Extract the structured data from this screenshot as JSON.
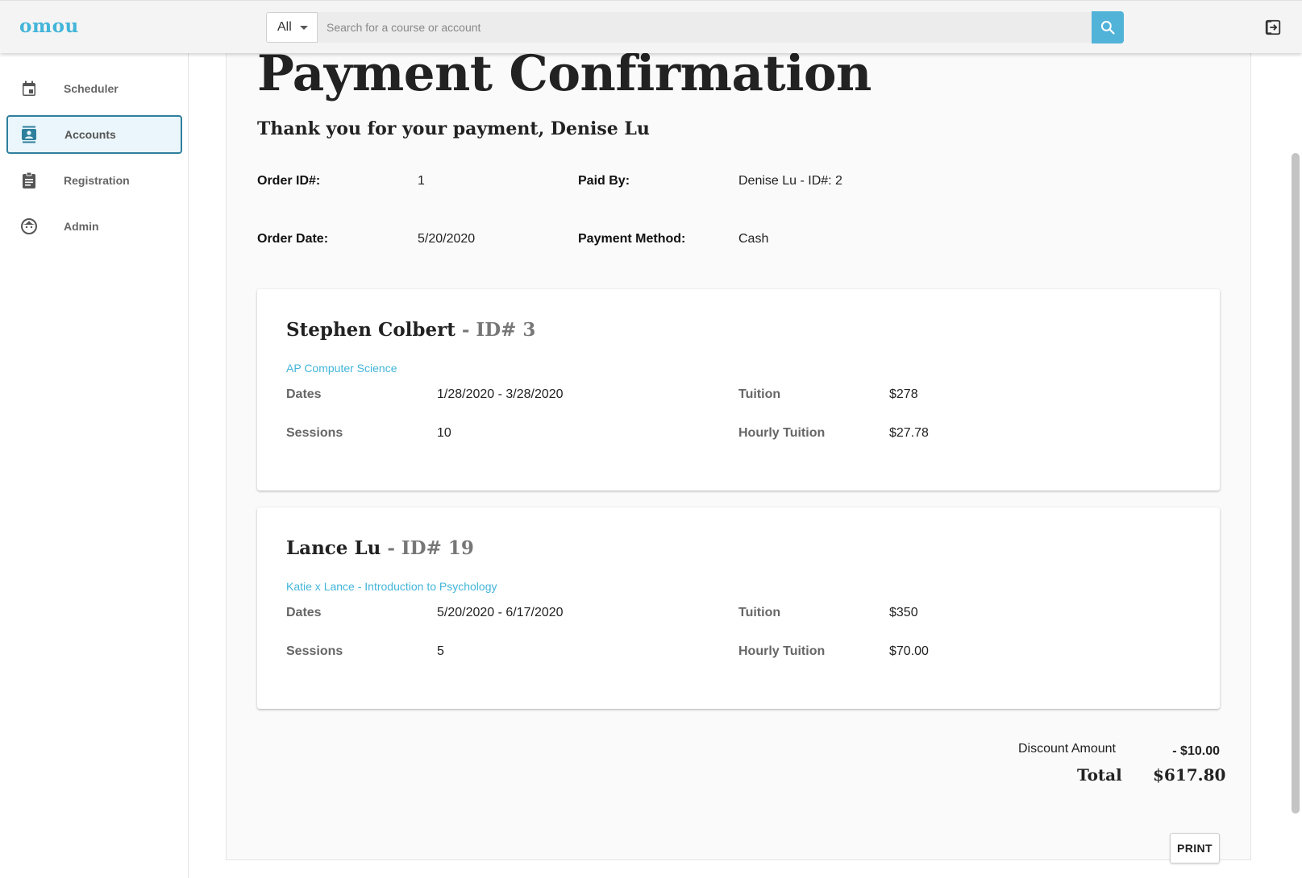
{
  "app": {
    "logo": "omou"
  },
  "search": {
    "filter_value": "All",
    "placeholder": "Search for a course or account"
  },
  "icons": {
    "search": "search-icon",
    "logout": "logout-icon"
  },
  "colors": {
    "accent": "#52b3d9",
    "link": "#43b5d9",
    "active_border": "#2e7f9c"
  },
  "sidebar": {
    "items": [
      {
        "label": "Scheduler",
        "icon": "calendar-icon",
        "active": false
      },
      {
        "label": "Accounts",
        "icon": "contacts-icon",
        "active": true
      },
      {
        "label": "Registration",
        "icon": "clipboard-icon",
        "active": false
      },
      {
        "label": "Admin",
        "icon": "face-icon",
        "active": false
      }
    ]
  },
  "page": {
    "title": "Payment Confirmation",
    "thanks": "Thank you for your payment, Denise Lu",
    "order_id_label": "Order ID#:",
    "order_id": "1",
    "paid_by_label": "Paid By:",
    "paid_by": "Denise Lu - ID#: 2",
    "order_date_label": "Order Date:",
    "order_date": "5/20/2020",
    "payment_method_label": "Payment Method:",
    "payment_method": "Cash"
  },
  "cards": [
    {
      "student": "Stephen Colbert",
      "student_id": " - ID# 3",
      "course": "AP Computer Science",
      "dates_label": "Dates",
      "dates": "1/28/2020 - 3/28/2020",
      "sessions_label": "Sessions",
      "sessions": "10",
      "tuition_label": "Tuition",
      "tuition": "$278",
      "hourly_label": "Hourly Tuition",
      "hourly": "$27.78"
    },
    {
      "student": "Lance Lu",
      "student_id": " - ID# 19",
      "course": "Katie x Lance - Introduction to Psychology",
      "dates_label": "Dates",
      "dates": "5/20/2020 - 6/17/2020",
      "sessions_label": "Sessions",
      "sessions": "5",
      "tuition_label": "Tuition",
      "tuition": "$350",
      "hourly_label": "Hourly Tuition",
      "hourly": "$70.00"
    }
  ],
  "summary": {
    "discount_label": "Discount Amount",
    "discount": "- $10.00",
    "total_label": "Total",
    "total": "$617.80"
  },
  "actions": {
    "print_label": "PRINT"
  }
}
